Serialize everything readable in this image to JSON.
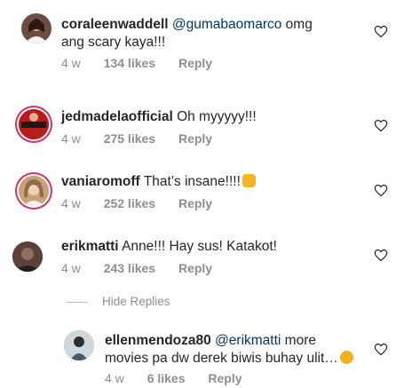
{
  "comments": [
    {
      "username": "coraleenwaddell",
      "mention": "@gumabaomarco",
      "text_part1": " omg",
      "text_line2": "ang scary kaya!!!",
      "time": "4 w",
      "likes": "134 likes",
      "reply": "Reply",
      "avatar_icon": "profile-photo-icon",
      "colors": {
        "avatar_bg": "#6d4c41"
      }
    },
    {
      "username": "jedmadelaofficial",
      "text": " Oh myyyyy!!!",
      "time": "4 w",
      "likes": "275 likes",
      "reply": "Reply",
      "avatar_icon": "profile-photo-icon",
      "colors": {
        "avatar_bg": "#b71c1c"
      }
    },
    {
      "username": "vaniaromoff",
      "text": " That’s insane!!!!",
      "emoji": "scream-cat-emoji",
      "time": "4 w",
      "likes": "252 likes",
      "reply": "Reply",
      "avatar_icon": "profile-photo-icon",
      "colors": {
        "avatar_bg": "#a1887f"
      }
    },
    {
      "username": "erikmatti",
      "text": " Anne!!! Hay sus! Katakot!",
      "time": "4 w",
      "likes": "243 likes",
      "reply": "Reply",
      "avatar_icon": "profile-photo-icon",
      "colors": {
        "avatar_bg": "#3e2723"
      }
    }
  ],
  "hide_replies": "Hide Replies",
  "reply_comment": {
    "username": "ellenmendoza80",
    "mention": "@erikmatti",
    "text_part1": " more",
    "text_line2": "movies pa dw derek biwis buhay ulit…",
    "emoji": "smiling-face-emoji",
    "time": "4 w",
    "likes": "6 likes",
    "reply": "Reply",
    "avatar_icon": "profile-photo-icon",
    "colors": {
      "avatar_bg": "#607d8b"
    }
  },
  "icons": {
    "like": "heart-outline-icon"
  }
}
